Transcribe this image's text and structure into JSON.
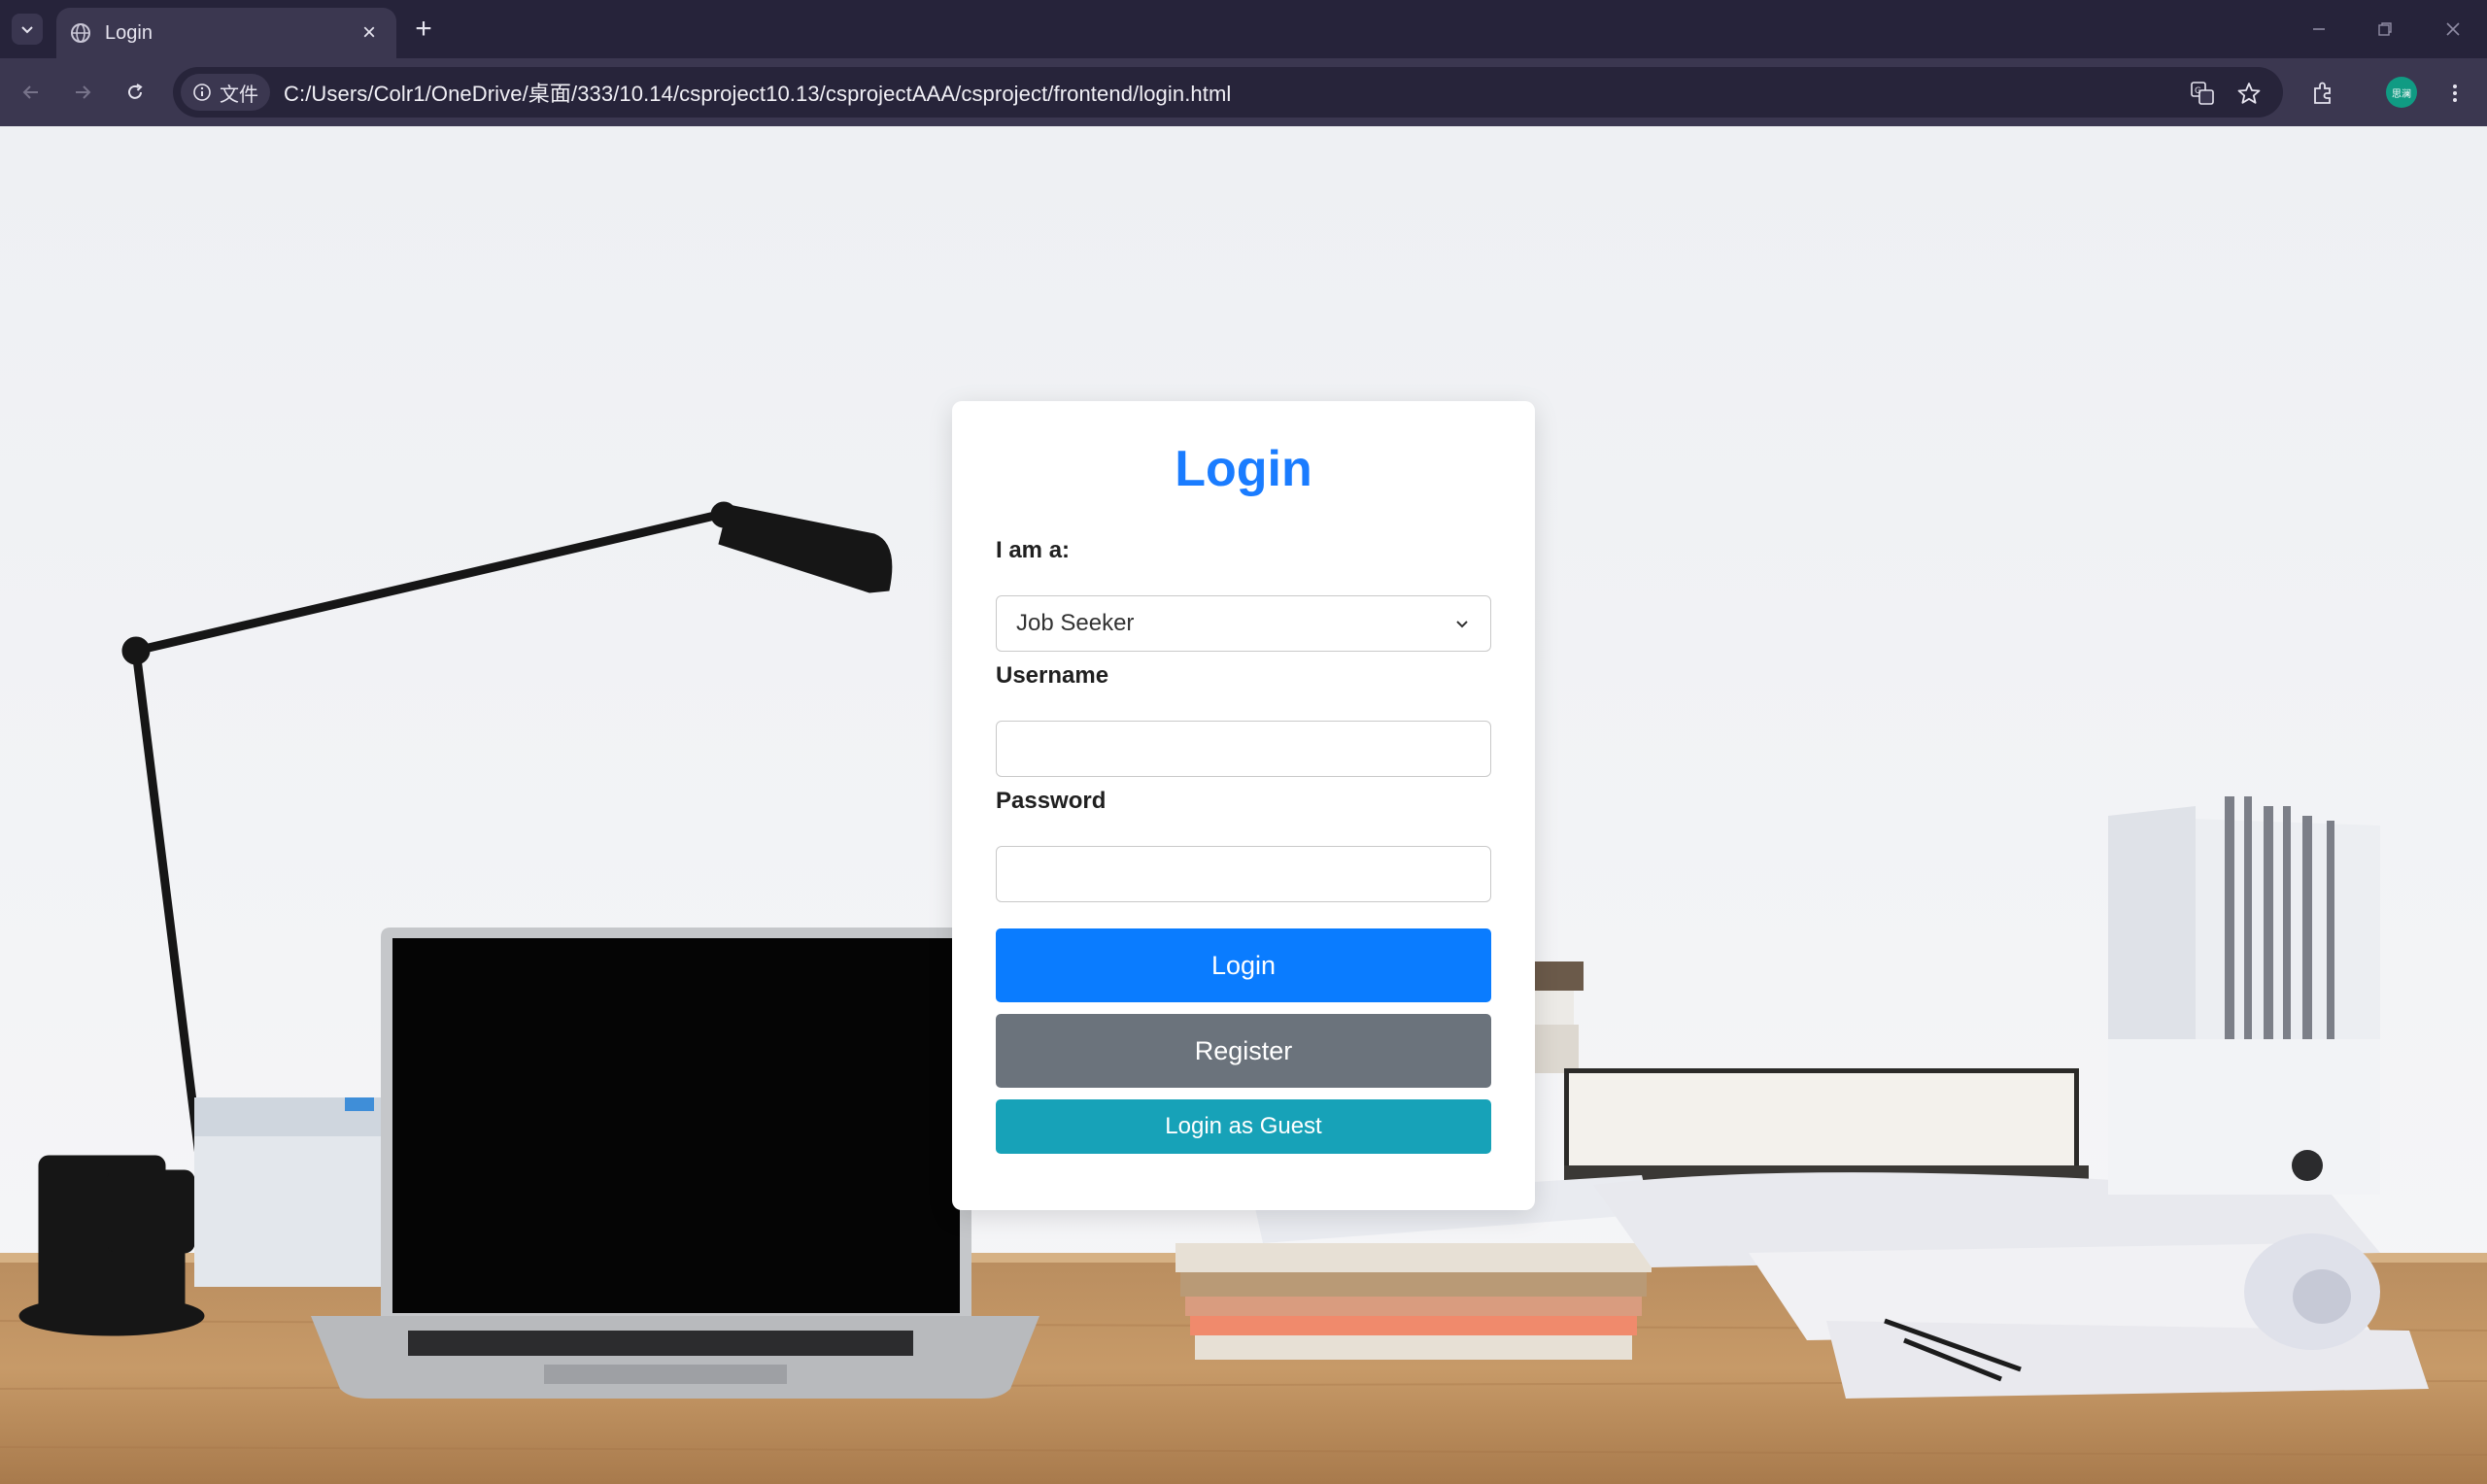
{
  "browser": {
    "tab_title": "Login",
    "close_glyph": "×",
    "new_tab_glyph": "+",
    "site_chip_label": "文件",
    "url": "C:/Users/Colr1/OneDrive/桌面/333/10.14/csproject10.13/csprojectAAA/csproject/frontend/login.html",
    "profile_label": "思澜",
    "icons": [
      "tab-search-icon",
      "globe-icon",
      "close-icon",
      "plus-icon",
      "back-icon",
      "forward-icon",
      "reload-icon",
      "info-icon",
      "translate-icon",
      "star-icon",
      "extensions-icon",
      "more-icon",
      "minimize-icon",
      "restore-icon",
      "window-close-icon"
    ]
  },
  "login": {
    "title": "Login",
    "role_label": "I am a:",
    "role_value": "Job Seeker",
    "username_label": "Username",
    "username_value": "",
    "password_label": "Password",
    "password_value": "",
    "login_button": "Login",
    "register_button": "Register",
    "guest_button": "Login as Guest"
  },
  "colors": {
    "title": "#1a7cff",
    "login_button": "#0a7cff",
    "register_button": "#6b737c",
    "guest_button": "#17a2b8",
    "chrome_dark": "#26233a",
    "chrome_toolbar": "#3b3750"
  }
}
